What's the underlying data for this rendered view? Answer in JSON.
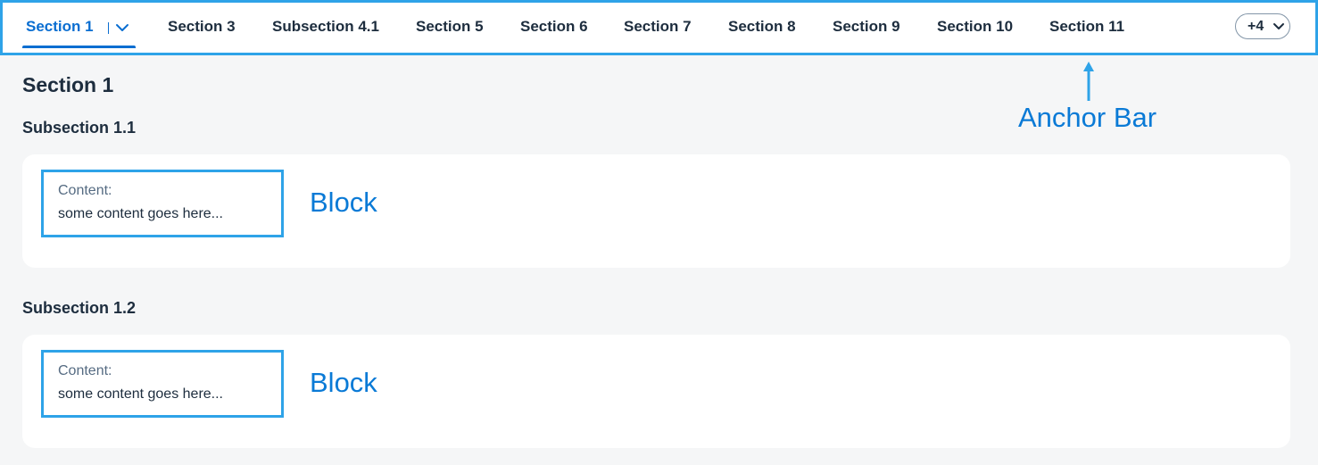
{
  "anchor_bar": {
    "tabs": [
      {
        "label": "Section 1",
        "selected": true
      },
      {
        "label": "Section 3"
      },
      {
        "label": "Subsection 4.1"
      },
      {
        "label": "Section 5"
      },
      {
        "label": "Section 6"
      },
      {
        "label": "Section 7"
      },
      {
        "label": "Section 8"
      },
      {
        "label": "Section 9"
      },
      {
        "label": "Section 10"
      },
      {
        "label": "Section 11"
      }
    ],
    "overflow_label": "+4",
    "overflow_icon": "chevron-down-icon",
    "selected_tab_icon": "chevron-down-icon"
  },
  "annotations": {
    "anchor_bar": "Anchor Bar",
    "block": "Block"
  },
  "content": {
    "section_title": "Section 1",
    "subsections": [
      {
        "title": "Subsection 1.1",
        "block": {
          "label": "Content:",
          "value": "some content goes here..."
        }
      },
      {
        "title": "Subsection 1.2",
        "block": {
          "label": "Content:",
          "value": "some content goes here..."
        }
      }
    ]
  },
  "colors": {
    "accent": "#0a6ed1",
    "highlight_border": "#2ea3e8",
    "annotation_text": "#0a7ad6",
    "page_background": "#f5f6f7"
  }
}
